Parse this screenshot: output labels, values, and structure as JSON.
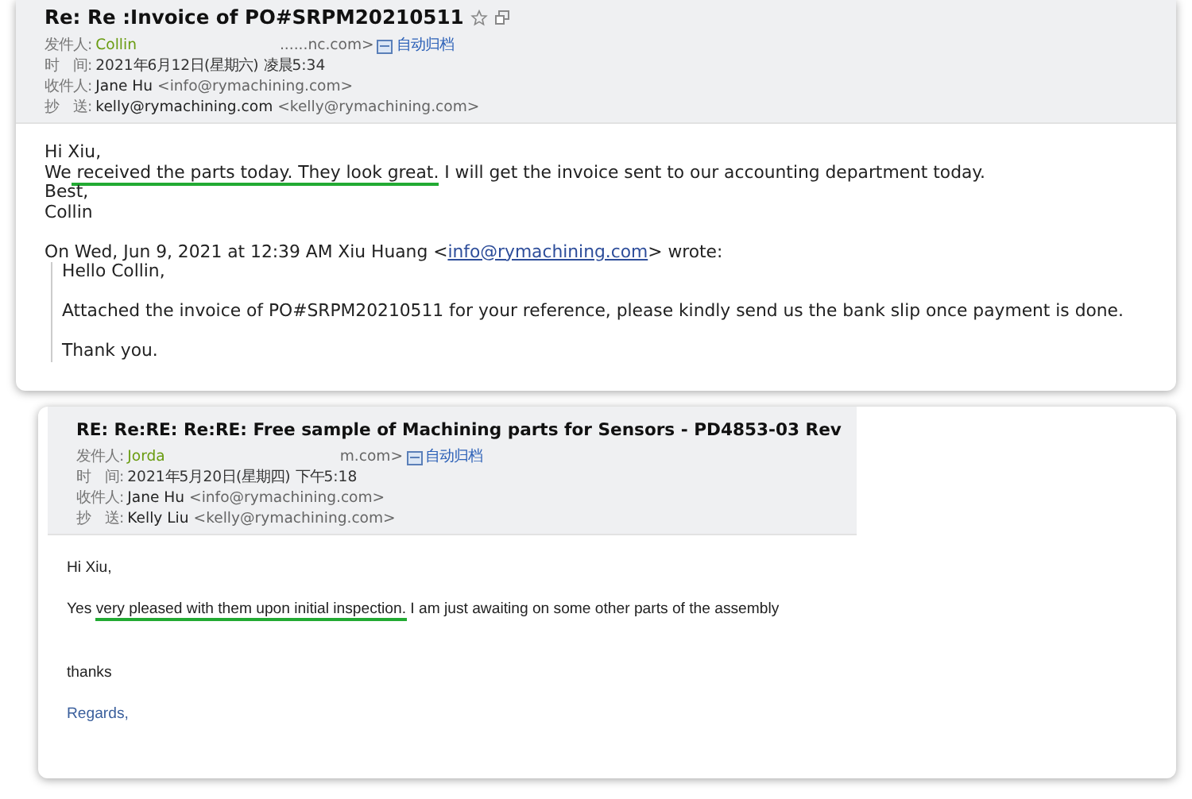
{
  "emails": [
    {
      "kind": "webmail",
      "subject": "Re: Re :Invoice of PO#SRPM20210511",
      "meta": [
        {
          "label": "发件人:",
          "kind": "sender",
          "name": "Collin",
          "address": "......nc.com>",
          "archive": "自动归档"
        },
        {
          "label": "时　间:",
          "kind": "plain",
          "value": "2021年6月12日(星期六) 凌晨5:34"
        },
        {
          "label": "收件人:",
          "kind": "contact",
          "name": "Jane Hu",
          "address": "<info@rymachining.com>"
        },
        {
          "label": "抄　送:",
          "kind": "contact",
          "name": "kelly@rymachining.com",
          "address": "<kelly@rymachining.com>"
        }
      ],
      "body": [
        {
          "text": "Hi Xiu,"
        },
        {
          "before": "We",
          "marked": " received the parts today. They look great.",
          "after": " I will get the invoice sent to our accounting department today."
        },
        {
          "text": "Best,"
        },
        {
          "text": "Collin"
        }
      ],
      "quote_intro": {
        "before": "On Wed, Jun 9, 2021 at 12:39 AM Xiu Huang <",
        "link": "info@rymachining.com",
        "after": "> wrote:"
      },
      "quote": [
        "Hello Collin,",
        "Attached the invoice of PO#SRPM20210511 for your reference, please kindly send us the bank slip once payment is done.",
        "Thank you."
      ]
    },
    {
      "kind": "outlook",
      "subject": "RE: Re:RE: Re:RE: Free sample of Machining parts for Sensors  - PD4853-03 Rev",
      "meta": [
        {
          "label": "发件人:",
          "kind": "sender",
          "name": "Jorda",
          "address": "m.com>",
          "archive": "自动归档"
        },
        {
          "label": "时　间:",
          "kind": "plain",
          "value": "2021年5月20日(星期四) 下午5:18"
        },
        {
          "label": "收件人:",
          "kind": "contact",
          "name": "Jane Hu",
          "address": "<info@rymachining.com>"
        },
        {
          "label": "抄　送:",
          "kind": "contact",
          "name": "Kelly Liu",
          "address": "<kelly@rymachining.com>"
        }
      ],
      "body": [
        {
          "text": "Hi Xiu,"
        },
        {
          "before": "Yes ",
          "marked": "very pleased with them upon initial inspection.",
          "after": " I am just awaiting on some other parts of the assembly"
        },
        {
          "text": "thanks"
        },
        {
          "text": "Regards,",
          "kind": "signature"
        }
      ]
    }
  ]
}
